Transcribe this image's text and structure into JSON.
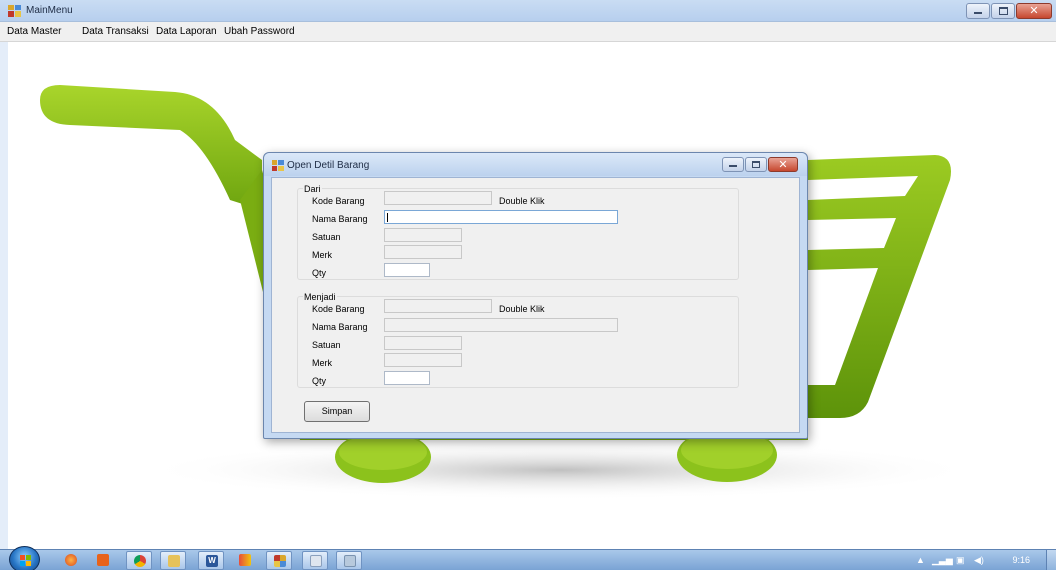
{
  "main_window": {
    "title": "MainMenu",
    "menu": [
      "Data Master",
      "Data Transaksi",
      "Data Laporan",
      "Ubah Password"
    ]
  },
  "dialog": {
    "title": "Open Detil Barang",
    "groups": [
      {
        "legend": "Dari",
        "labels": {
          "kode": "Kode Barang",
          "nama": "Nama Barang",
          "satuan": "Satuan",
          "merk": "Merk",
          "qty": "Qty"
        },
        "hint": "Double Klik",
        "values": {
          "kode": "",
          "nama": "",
          "satuan": "",
          "merk": "",
          "qty": ""
        }
      },
      {
        "legend": "Menjadi",
        "labels": {
          "kode": "Kode Barang",
          "nama": "Nama Barang",
          "satuan": "Satuan",
          "merk": "Merk",
          "qty": "Qty"
        },
        "hint": "Double Klik",
        "values": {
          "kode": "",
          "nama": "",
          "satuan": "",
          "merk": "",
          "qty": ""
        }
      }
    ],
    "save_button": "Simpan"
  },
  "taskbar": {
    "clock": "9:16",
    "tray_icons": [
      "arrow-up-icon",
      "signal-icon",
      "network-icon",
      "volume-icon"
    ],
    "apps": [
      "firefox-icon",
      "media-icon",
      "chrome-icon",
      "explorer-icon",
      "word-icon",
      "app-icon",
      "mainmenu-app-icon",
      "window-icon",
      "tool-icon"
    ]
  },
  "colors": {
    "cart_green": "#8cc21c",
    "cart_green_dark": "#5e9409",
    "titlebar_blue": "#c9dcf3",
    "close_red": "#c6472f"
  }
}
